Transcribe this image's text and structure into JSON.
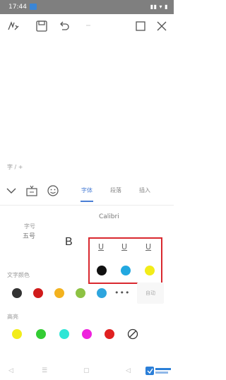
{
  "status_bar": {
    "time": "17:44",
    "icons": "▮▮ ▾ ▮"
  },
  "toolbar": {
    "icons": [
      "pen-settings",
      "save",
      "undo",
      "redo",
      "fullscreen",
      "close"
    ]
  },
  "hint": {
    "text": "字 / +"
  },
  "panel_tabs": {
    "icons": [
      "collapse",
      "keyboard",
      "emoji"
    ],
    "tabs": [
      {
        "label": "字体",
        "active": true
      },
      {
        "label": "段落",
        "active": false
      },
      {
        "label": "插入",
        "active": false
      }
    ]
  },
  "font_section": {
    "label_top": "字号",
    "label_bottom": "五号",
    "font_name": "Calibri",
    "bold": "B",
    "underline_options": [
      "U",
      "U",
      "U"
    ],
    "underline_colors": [
      "#111111",
      "#22a8e0",
      "#f2ec19"
    ]
  },
  "text_color": {
    "label": "文字颜色",
    "colors": [
      "#333333",
      "#d01b1b",
      "#f3b21f",
      "#8dc243",
      "#2ea5de"
    ],
    "more": "•••",
    "auto_label": "自动"
  },
  "highlight_color": {
    "label": "高亮",
    "colors": [
      "#f2ec19",
      "#33cc33",
      "#2ee6d6",
      "#ee22dd",
      "#e02020"
    ]
  },
  "nav_bar": {
    "icons": [
      "back",
      "menu",
      "home",
      "recent"
    ]
  },
  "colors": {
    "accent": "#4b7fd6",
    "highlight_frame": "#d9282f"
  }
}
